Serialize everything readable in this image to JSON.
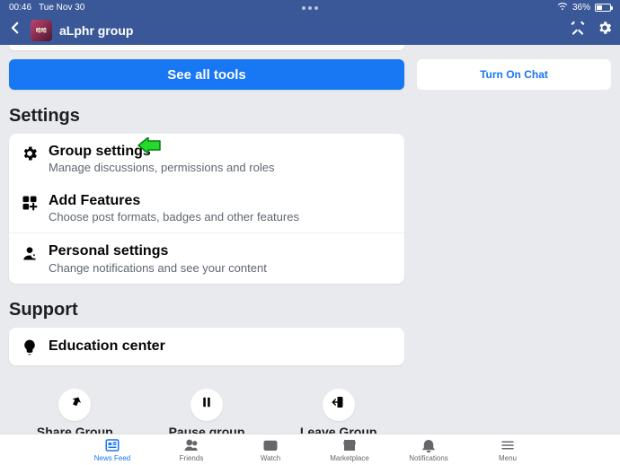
{
  "status": {
    "time": "00:46",
    "date": "Tue Nov 30",
    "battery_pct": "36%"
  },
  "header": {
    "title": "aLphr group"
  },
  "buttons": {
    "see_all_tools": "See all tools",
    "turn_on_chat": "Turn On Chat"
  },
  "sections": {
    "settings_heading": "Settings",
    "support_heading": "Support"
  },
  "rows": {
    "group_settings": {
      "title": "Group settings",
      "subtitle": "Manage discussions, permissions and roles"
    },
    "add_features": {
      "title": "Add Features",
      "subtitle": "Choose post formats, badges and other features"
    },
    "personal": {
      "title": "Personal settings",
      "subtitle": "Change notifications and see your content"
    },
    "education": {
      "title": "Education center"
    }
  },
  "actions": {
    "share": "Share Group",
    "pause": "Pause group",
    "leave": "Leave Group"
  },
  "nav": {
    "news_feed": "News Feed",
    "friends": "Friends",
    "watch": "Watch",
    "marketplace": "Marketplace",
    "notifications": "Notifications",
    "menu": "Menu"
  }
}
